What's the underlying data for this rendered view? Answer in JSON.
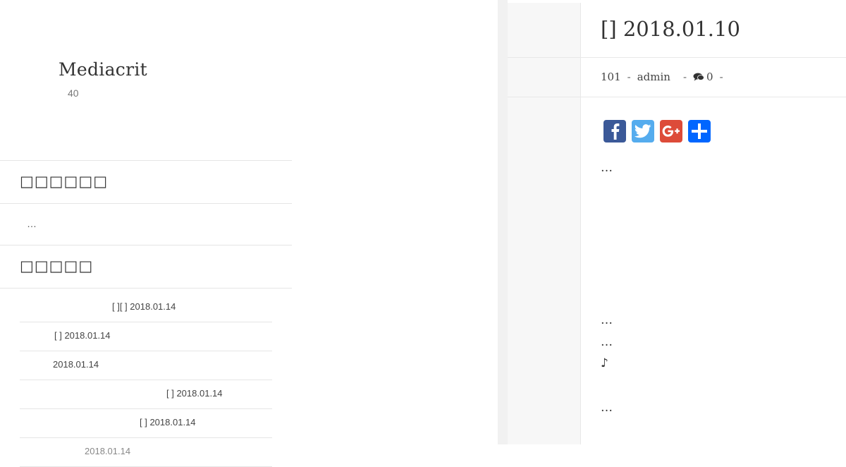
{
  "site": {
    "title": "Mediacrit",
    "description": "40"
  },
  "widgets": {
    "first_title": "□□□□□□",
    "first_body": "…",
    "second_title": "□□□□□",
    "recent_posts": [
      "[ ][ ] 2018.01.14",
      "[ ] 2018.01.14",
      "2018.01.14",
      "[ ] 2018.01.14",
      "[ ] 2018.01.14",
      "2018.01.14"
    ]
  },
  "post": {
    "title": "[] 2018.01.10",
    "meta": {
      "views": "101",
      "author": "admin",
      "comments": "0",
      "separator": "-"
    },
    "share_buttons": [
      {
        "name": "facebook",
        "color": "#3b5998"
      },
      {
        "name": "twitter",
        "color": "#55acee"
      },
      {
        "name": "google-plus",
        "color": "#dd4b39"
      },
      {
        "name": "share",
        "color": "#0166ff"
      }
    ],
    "paragraphs": [
      "…",
      "…",
      "…",
      "♪",
      "…"
    ]
  }
}
